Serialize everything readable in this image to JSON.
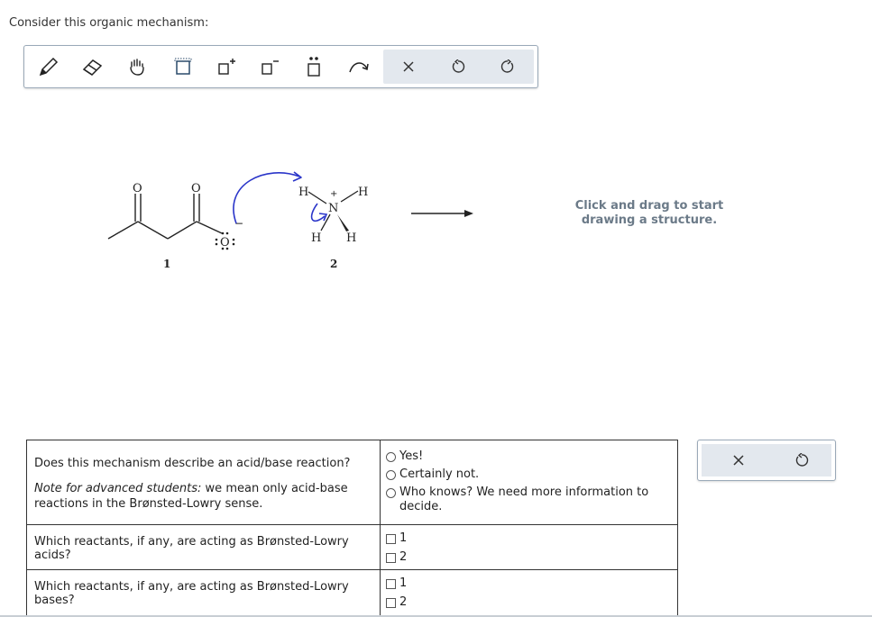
{
  "prompt": "Consider this organic mechanism:",
  "toolbar": {
    "tools": [
      "pencil-icon",
      "eraser-icon",
      "hand-icon",
      "selection-box-icon",
      "add-positive-charge-icon",
      "add-negative-charge-icon",
      "lone-pair-icon",
      "arrow-curve-icon"
    ],
    "actions": [
      "clear-icon",
      "undo-icon",
      "redo-icon"
    ],
    "accent": "#1a1a1a"
  },
  "mechanism": {
    "reactant1_label": "1",
    "reactant2_label": "2",
    "atoms": {
      "o_carbonyl": "O",
      "o_carboxyl": "O",
      "o_anion": "O",
      "n": "N",
      "h_top_left": "H",
      "h_top_right": "H",
      "h_bottom_left": "H",
      "h_bottom_right": "H"
    },
    "charges": {
      "anion": "−",
      "cation": "+"
    },
    "arrow_color": "#2a35c9"
  },
  "product_area": {
    "hint": "Click and drag to start drawing a structure."
  },
  "questions": [
    {
      "title": "Does this mechanism describe an acid/base reaction?",
      "note_em": "Note for advanced students:",
      "note_rest": " we mean only acid-base reactions in the Brønsted-Lowry sense.",
      "options": [
        "Yes!",
        "Certainly not.",
        "Who knows? We need more information to decide."
      ]
    },
    {
      "title": "Which reactants, if any, are acting as Brønsted-Lowry acids?",
      "options": [
        "1",
        "2"
      ]
    },
    {
      "title": "Which reactants, if any, are acting as Brønsted-Lowry bases?",
      "options": [
        "1",
        "2"
      ]
    }
  ],
  "side_panel": {
    "actions": [
      "close-icon",
      "reset-icon"
    ]
  }
}
